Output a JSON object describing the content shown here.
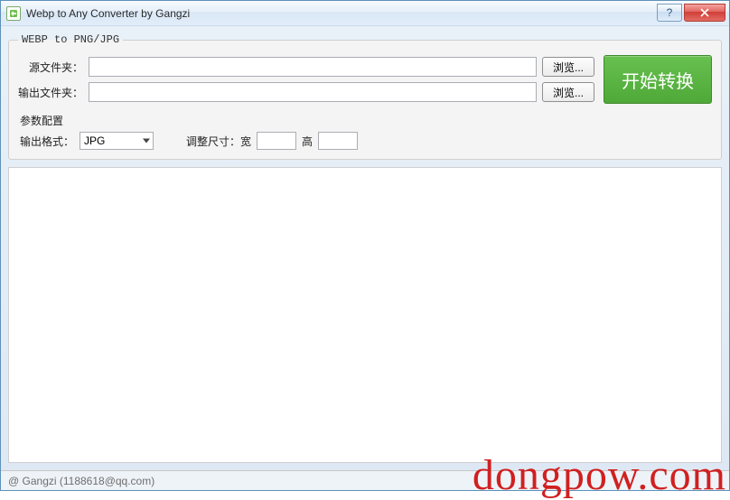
{
  "window": {
    "title": "Webp to Any Converter by Gangzi",
    "help_tooltip": "?",
    "close_tooltip": "Close"
  },
  "group": {
    "legend": "WEBP to PNG/JPG"
  },
  "source": {
    "label": "源文件夹：",
    "value": "",
    "browse_label": "浏览..."
  },
  "output": {
    "label": "输出文件夹：",
    "value": "",
    "browse_label": "浏览..."
  },
  "start": {
    "label": "开始转换"
  },
  "params": {
    "title": "参数配置",
    "format_label": "输出格式：",
    "format_value": "JPG",
    "resize_label": "调整尺寸：宽",
    "width_value": "",
    "height_label": "高",
    "height_value": ""
  },
  "status": {
    "text": "@ Gangzi (1188618@qq.com)"
  },
  "watermark": "dongpow.com"
}
